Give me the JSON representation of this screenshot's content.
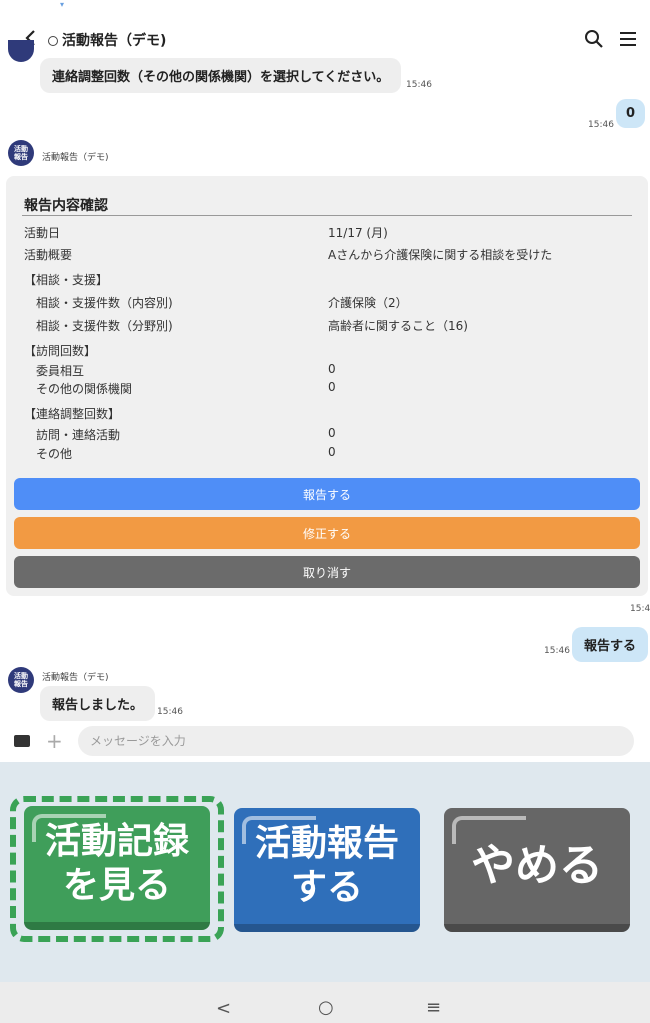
{
  "header": {
    "title": "活動報告（デモ)"
  },
  "messages": {
    "prompt_text": "連絡調整回数（その他の関係機関）を選択してください。",
    "prompt_time": "15:46",
    "reply_value": "0",
    "reply_time": "15:46",
    "bot_name": "活動報告（デモ)",
    "bot_avatar_text": "活動報告",
    "bot_name2": "活動報告（デモ)",
    "final_user_text": "報告する",
    "final_user_time": "15:46",
    "card_time": "15:4",
    "bot_reply": "報告しました。",
    "bot_reply_time": "15:46"
  },
  "report": {
    "title": "報告内容確認",
    "rows": [
      {
        "label": "活動日",
        "value": "11/17 (月)"
      },
      {
        "label": "活動概要",
        "value": "Aさんから介護保険に関する相談を受けた"
      },
      {
        "label": "【相談・支援】",
        "value": ""
      },
      {
        "label": "相談・支援件数（内容別)",
        "value": "介護保険（2）"
      },
      {
        "label": "相談・支援件数（分野別)",
        "value": "高齢者に関すること（16)"
      },
      {
        "label": "【訪問回数】",
        "value": ""
      },
      {
        "label": "委員相互",
        "value": "0"
      },
      {
        "label": "その他の関係機関",
        "value": "0"
      },
      {
        "label": "【連絡調整回数】",
        "value": ""
      },
      {
        "label": "訪問・連絡活動",
        "value": "0"
      },
      {
        "label": "その他",
        "value": "0"
      }
    ],
    "buttons": {
      "submit": "報告する",
      "edit": "修正する",
      "cancel": "取り消す"
    }
  },
  "input": {
    "placeholder": "メッセージを入力"
  },
  "big_buttons": {
    "view_records": "活動記録\nを見る",
    "report": "活動報告\nする",
    "quit": "やめる"
  },
  "colors": {
    "blue_button": "#4f8ef7",
    "orange_button": "#f29a43",
    "gray_button": "#6b6b6b",
    "green_big": "#3f9e5a",
    "blue_big": "#2f6fba",
    "gray_big": "#666666",
    "dash_frame": "#3aa356"
  },
  "icons": [
    "back-icon",
    "search-icon",
    "menu-icon",
    "keyboard-icon",
    "plus-icon",
    "nav-back-icon",
    "nav-home-icon",
    "nav-recent-icon"
  ],
  "navbar": {
    "back": "<",
    "home": "○",
    "recent": "≡"
  }
}
